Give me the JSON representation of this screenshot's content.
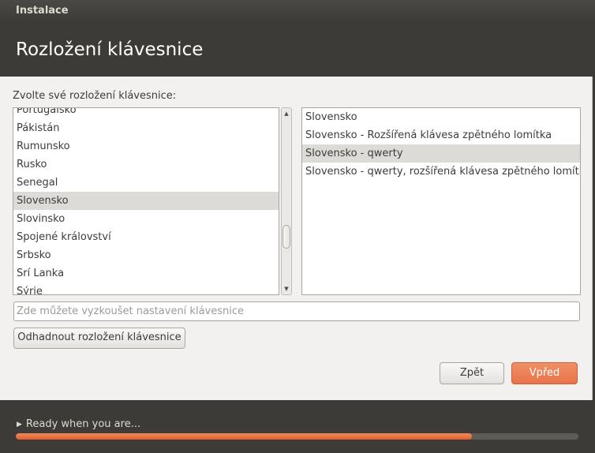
{
  "window": {
    "title": "Instalace"
  },
  "header": {
    "title": "Rozložení klávesnice"
  },
  "main": {
    "prompt": "Zvolte své rozložení klávesnice:",
    "layouts": [
      "Portugalsko",
      "Pákistán",
      "Rumunsko",
      "Rusko",
      "Senegal",
      "Slovensko",
      "Slovinsko",
      "Spojené království",
      "Srbsko",
      "Srí Lanka",
      "Sýrie"
    ],
    "layouts_selected_index": 5,
    "variants": [
      "Slovensko",
      "Slovensko - Rozšířená klávesa zpětného lomítka",
      "Slovensko - qwerty",
      "Slovensko - qwerty, rozšířená klávesa zpětného lomítka"
    ],
    "variants_selected_index": 2,
    "test_input": {
      "value": "",
      "placeholder": "Zde můžete vyzkoušet nastavení klávesnice"
    },
    "detect_button": "Odhadnout rozložení klávesnice",
    "back_button": "Zpět",
    "forward_button": "Vpřed"
  },
  "footer": {
    "status": "Ready when you are...",
    "progress_percent": 81
  },
  "colors": {
    "accent": "#e8744a",
    "header_bg": "#3c3b37",
    "selection": "#dcdbd8"
  }
}
